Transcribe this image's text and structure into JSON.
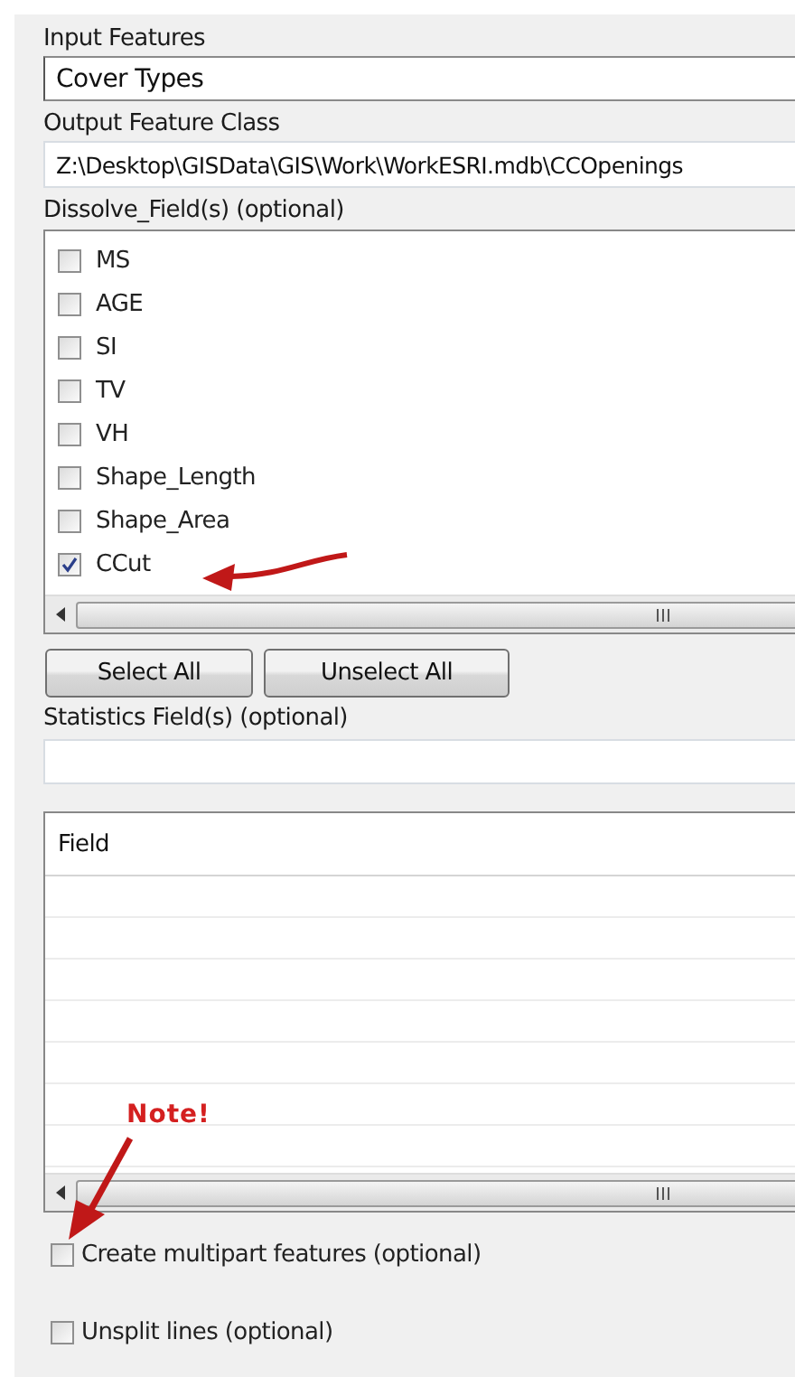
{
  "input_features": {
    "label": "Input Features",
    "value": "Cover Types"
  },
  "output_feature_class": {
    "label": "Output Feature Class",
    "value": "Z:\\Desktop\\GISData\\GIS\\Work\\WorkESRI.mdb\\CCOpenings"
  },
  "dissolve_fields": {
    "label": "Dissolve_Field(s) (optional)",
    "items": [
      {
        "label": "MS",
        "checked": false
      },
      {
        "label": "AGE",
        "checked": false
      },
      {
        "label": "SI",
        "checked": false
      },
      {
        "label": "TV",
        "checked": false
      },
      {
        "label": "VH",
        "checked": false
      },
      {
        "label": "Shape_Length",
        "checked": false
      },
      {
        "label": "Shape_Area",
        "checked": false
      },
      {
        "label": "CCut",
        "checked": true
      }
    ]
  },
  "buttons": [
    "Select All",
    "Unselect All"
  ],
  "statistics_fields": {
    "label": "Statistics Field(s) (optional)",
    "table": {
      "columns": [
        "Field"
      ]
    }
  },
  "options": [
    {
      "label": "Create multipart features (optional)",
      "checked": false
    },
    {
      "label": "Unsplit lines (optional)",
      "checked": false
    }
  ],
  "annotations": [
    {
      "kind": "arrow_left"
    },
    {
      "kind": "note",
      "text": "Note!"
    }
  ]
}
